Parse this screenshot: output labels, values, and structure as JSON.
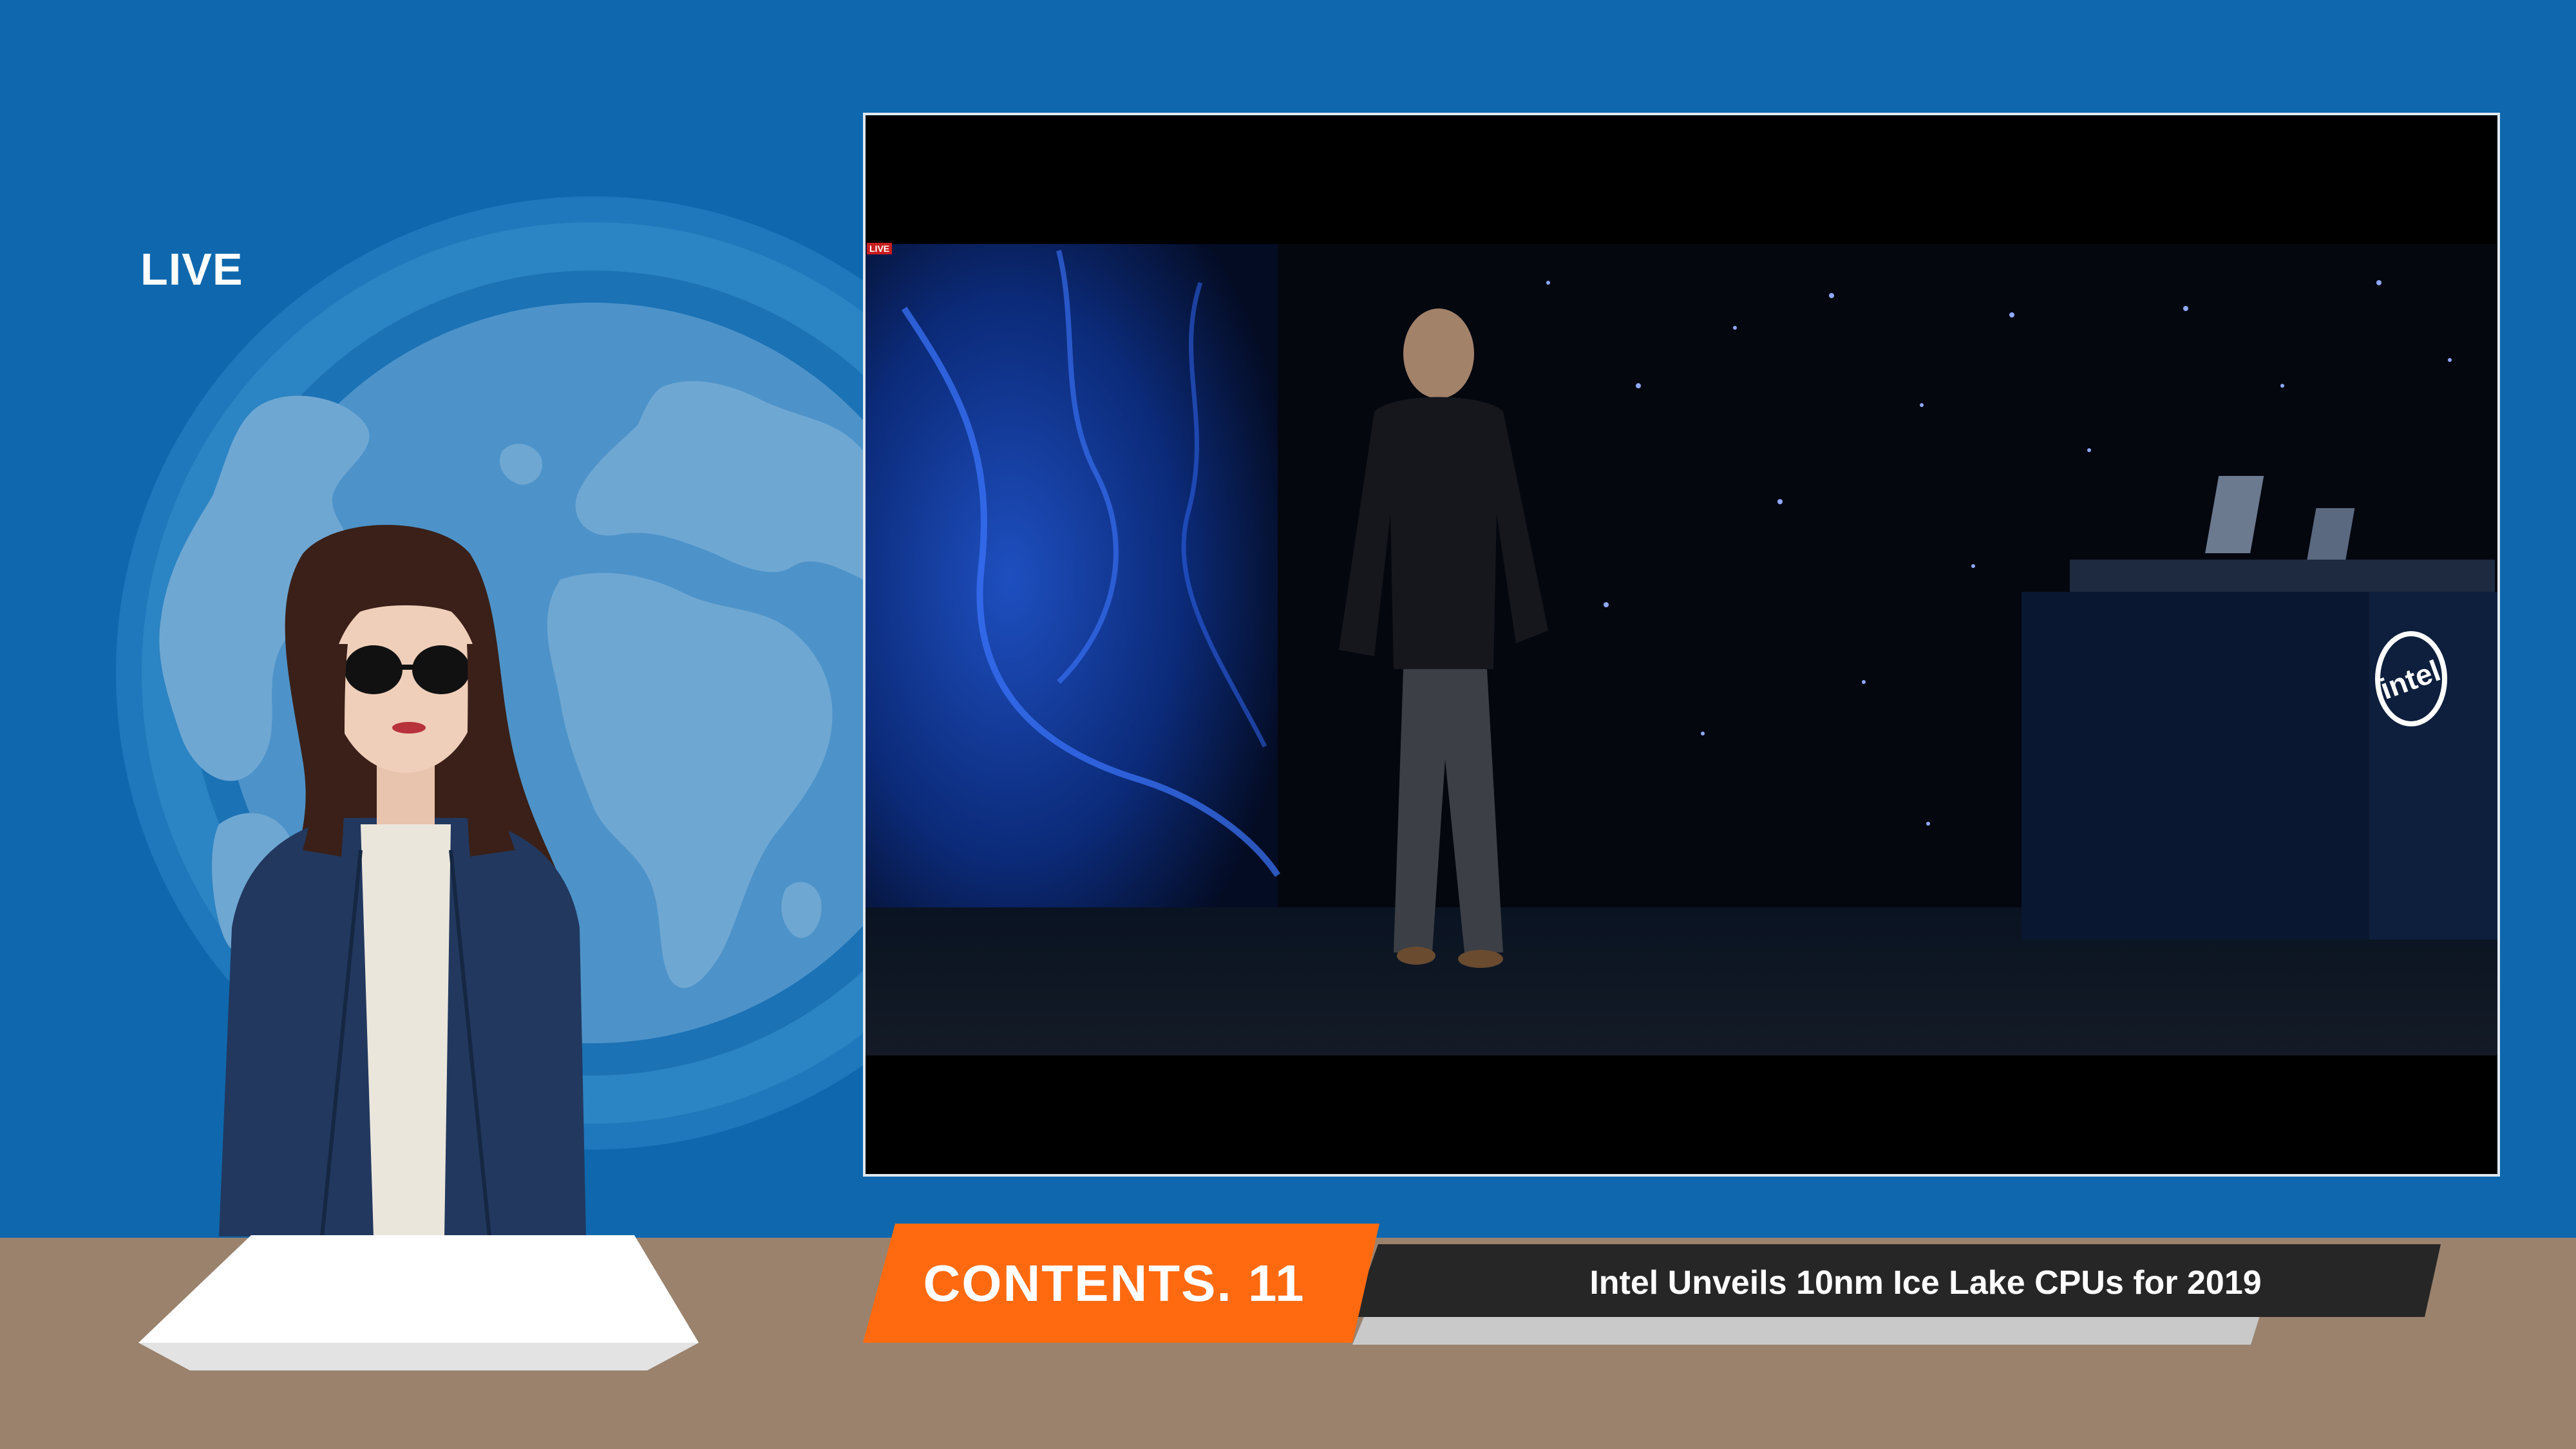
{
  "live_label": "LIVE",
  "video": {
    "badge": "LIVE",
    "stage_logo": "intel"
  },
  "lower_third": {
    "segment_label": "CONTENTS. 11",
    "headline": "Intel Unveils 10nm Ice Lake CPUs for 2019"
  },
  "colors": {
    "background_blue": "#0f68ad",
    "floor": "#9a826d",
    "segment_orange": "#ff6a10",
    "headline_bar": "#262626",
    "globe_light": "#6fa7d3"
  },
  "icons": [
    "globe-icon",
    "intel-logo-icon"
  ]
}
